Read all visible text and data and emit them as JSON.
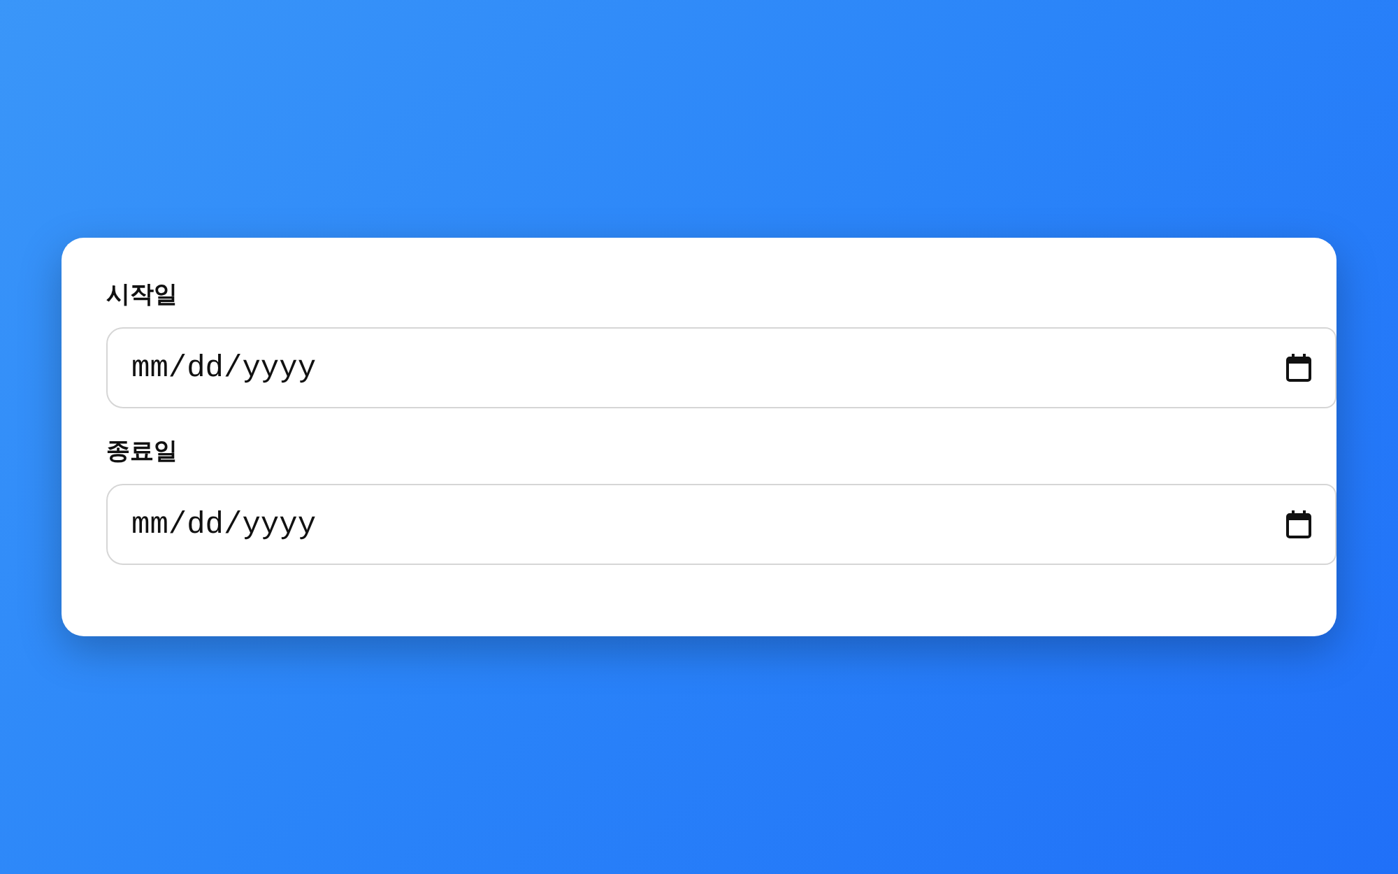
{
  "fields": [
    {
      "label": "시작일",
      "placeholder": "mm/dd/yyyy"
    },
    {
      "label": "종료일",
      "placeholder": "mm/dd/yyyy"
    }
  ]
}
